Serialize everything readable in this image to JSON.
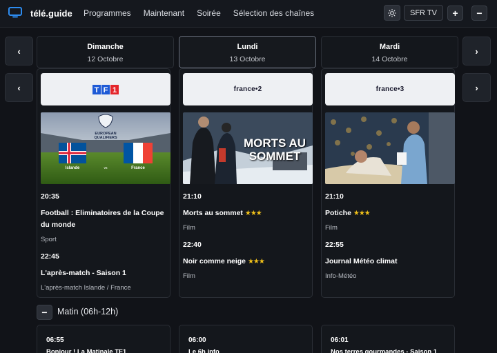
{
  "header": {
    "brand": "télé.guide",
    "nav": [
      "Programmes",
      "Maintenant",
      "Soirée",
      "Sélection des chaînes"
    ],
    "provider": "SFR TV",
    "plus_label": "+",
    "minus_label": "−"
  },
  "arrows": {
    "prev": "‹",
    "next": "›"
  },
  "days": [
    {
      "name": "Dimanche",
      "date": "12 Octobre"
    },
    {
      "name": "Lundi",
      "date": "13 Octobre"
    },
    {
      "name": "Mardi",
      "date": "14 Octobre"
    }
  ],
  "channels": [
    {
      "logo_text": "TF1",
      "thumb_caption": "EUROPEAN QUALIFIERS",
      "thumb_left": "Islande",
      "thumb_vs": "vs",
      "thumb_right": "France",
      "programs": [
        {
          "time": "20:35",
          "title": "Football : Eliminatoires de la Coupe du monde",
          "stars": "",
          "genre": "Sport"
        },
        {
          "time": "22:45",
          "title": "L'après-match - Saison 1",
          "stars": "",
          "genre": "L'après-match Islande / France"
        }
      ]
    },
    {
      "logo_text": "france•2",
      "thumb_caption": "MORTS AU SOMMET",
      "programs": [
        {
          "time": "21:10",
          "title": "Morts au sommet",
          "stars": "★★★",
          "genre": "Film"
        },
        {
          "time": "22:40",
          "title": "Noir comme neige",
          "stars": "★★★",
          "genre": "Film"
        }
      ]
    },
    {
      "logo_text": "france•3",
      "programs": [
        {
          "time": "21:10",
          "title": "Potiche",
          "stars": "★★★",
          "genre": "Film"
        },
        {
          "time": "22:55",
          "title": "Journal Météo climat",
          "stars": "",
          "genre": "Info-Météo"
        }
      ]
    }
  ],
  "section": {
    "toggle": "−",
    "label": "Matin (06h-12h)"
  },
  "morning": [
    {
      "time": "06:55",
      "title": "Bonjour ! La Matinale TF1"
    },
    {
      "time": "06:00",
      "title": "Le 6h info"
    },
    {
      "time": "06:01",
      "title": "Nos terres gourmandes - Saison 1"
    }
  ],
  "colors": {
    "background": "#111318",
    "accent": "#2d8cf0",
    "stars": "#f2c21a"
  }
}
